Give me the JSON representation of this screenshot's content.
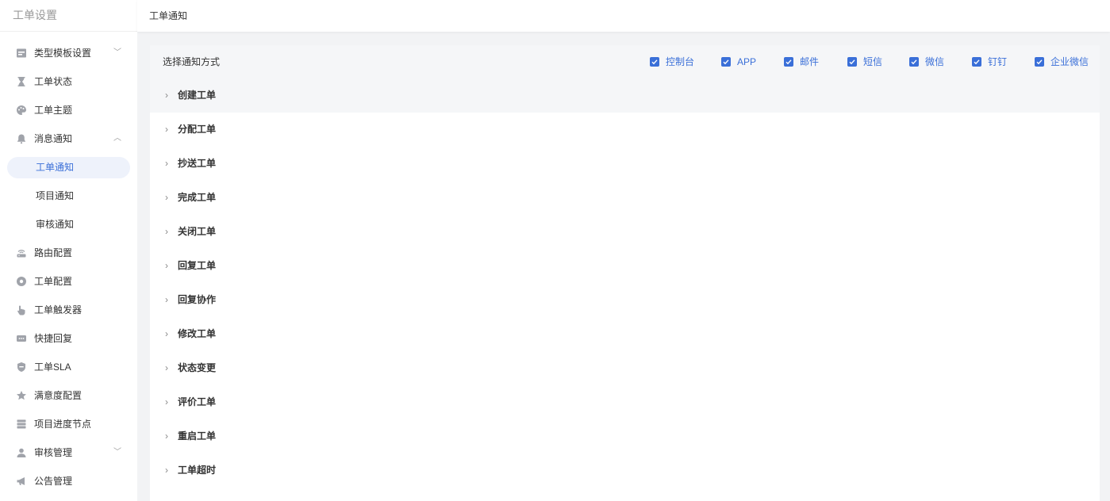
{
  "sidebar": {
    "title": "工单设置",
    "items": [
      {
        "label": "类型模板设置",
        "icon": "template-icon",
        "arrow": "﹀",
        "sub": false,
        "active": false
      },
      {
        "label": "工单状态",
        "icon": "hourglass-icon",
        "arrow": "",
        "sub": false,
        "active": false
      },
      {
        "label": "工单主题",
        "icon": "palette-icon",
        "arrow": "",
        "sub": false,
        "active": false
      },
      {
        "label": "消息通知",
        "icon": "bell-icon",
        "arrow": "︿",
        "sub": false,
        "active": false
      },
      {
        "label": "工单通知",
        "icon": "",
        "arrow": "",
        "sub": true,
        "active": true
      },
      {
        "label": "项目通知",
        "icon": "",
        "arrow": "",
        "sub": true,
        "active": false
      },
      {
        "label": "审核通知",
        "icon": "",
        "arrow": "",
        "sub": true,
        "active": false
      },
      {
        "label": "路由配置",
        "icon": "router-icon",
        "arrow": "",
        "sub": false,
        "active": false
      },
      {
        "label": "工单配置",
        "icon": "settings-icon",
        "arrow": "",
        "sub": false,
        "active": false
      },
      {
        "label": "工单触发器",
        "icon": "hand-pointer-icon",
        "arrow": "",
        "sub": false,
        "active": false
      },
      {
        "label": "快捷回复",
        "icon": "chat-icon",
        "arrow": "",
        "sub": false,
        "active": false
      },
      {
        "label": "工单SLA",
        "icon": "shield-icon",
        "arrow": "",
        "sub": false,
        "active": false
      },
      {
        "label": "满意度配置",
        "icon": "star-icon",
        "arrow": "",
        "sub": false,
        "active": false
      },
      {
        "label": "项目进度节点",
        "icon": "server-icon",
        "arrow": "",
        "sub": false,
        "active": false
      },
      {
        "label": "审核管理",
        "icon": "user-icon",
        "arrow": "﹀",
        "sub": false,
        "active": false
      },
      {
        "label": "公告管理",
        "icon": "megaphone-icon",
        "arrow": "",
        "sub": false,
        "active": false
      }
    ]
  },
  "header": {
    "title": "工单通知"
  },
  "panel": {
    "select_label": "选择通知方式",
    "methods": [
      {
        "label": "控制台",
        "checked": true
      },
      {
        "label": "APP",
        "checked": true
      },
      {
        "label": "邮件",
        "checked": true
      },
      {
        "label": "短信",
        "checked": true
      },
      {
        "label": "微信",
        "checked": true
      },
      {
        "label": "钉钉",
        "checked": true
      },
      {
        "label": "企业微信",
        "checked": true
      }
    ],
    "events": [
      "创建工单",
      "分配工单",
      "抄送工单",
      "完成工单",
      "关闭工单",
      "回复工单",
      "回复协作",
      "修改工单",
      "状态变更",
      "评价工单",
      "重启工单",
      "工单超时"
    ]
  },
  "colors": {
    "accent": "#3a6fd8",
    "active_bg": "#eef2fb",
    "icon_gray": "#a0a3aa"
  }
}
